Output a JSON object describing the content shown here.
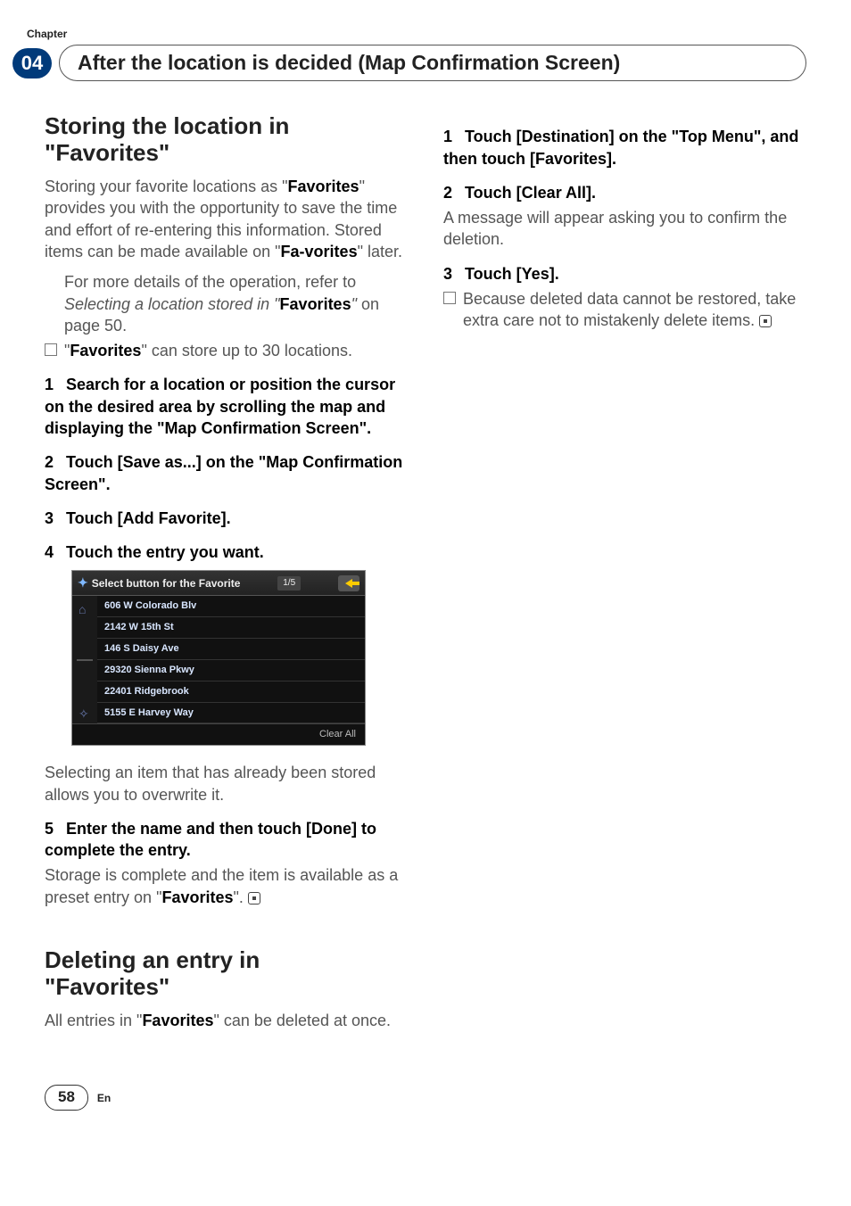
{
  "header": {
    "chapter_label": "Chapter",
    "chapter_num": "04",
    "title": "After the location is decided (Map Confirmation Screen)"
  },
  "left": {
    "sec1_title_a": "Storing the location in",
    "sec1_title_b": "\"Favorites\"",
    "sec1_para_a": "Storing your favorite locations as \"",
    "sec1_para_b": "Favorites",
    "sec1_para_c": "\" provides you with the opportunity to save the time and effort of re-entering this information. Stored items can be made available on \"",
    "sec1_para_d": "Fa-vorites",
    "sec1_para_e": "\" later.",
    "bul1_a": "For more details of the operation, refer to ",
    "bul1_b": "Selecting a location stored in \"",
    "bul1_c": "Favorites",
    "bul1_d": "\" ",
    "bul1_e": "on page 50.",
    "bul2_a": "\"",
    "bul2_b": "Favorites",
    "bul2_c": "\" can store up to 30 locations.",
    "step1": "Search for a location or position the cursor on the desired area by scrolling the map and displaying the \"Map Confirmation Screen\".",
    "step2": "Touch [Save as...] on the \"Map Confirmation Screen\".",
    "step3": "Touch [Add Favorite].",
    "step4": "Touch the entry you want.",
    "favshot": {
      "title": "Select button for the Favorite",
      "page": "1/5",
      "rows": [
        "606 W Colorado Blv",
        "2142 W 15th St",
        "146 S Daisy Ave",
        "29320 Sienna Pkwy",
        "22401 Ridgebrook",
        "5155 E Harvey Way"
      ],
      "clear": "Clear All"
    },
    "after_shot": "Selecting an item that has already been stored allows you to overwrite it.",
    "step5": "Enter the name and then touch [Done] to complete the entry.",
    "step5_after_a": "Storage is complete and the item is available as a preset entry on \"",
    "step5_after_b": "Favorites",
    "step5_after_c": "\".",
    "sec2_title_a": "Deleting an entry in",
    "sec2_title_b": "\"Favorites\"",
    "sec2_para_a": "All entries in \"",
    "sec2_para_b": "Favorites",
    "sec2_para_c": "\" can be deleted at once."
  },
  "right": {
    "step1": "Touch [Destination] on the \"Top Menu\", and then touch [Favorites].",
    "step2": "Touch [Clear All].",
    "step2_after": "A message will appear asking you to confirm the deletion.",
    "step3": "Touch [Yes].",
    "step3_bul": "Because deleted data cannot be restored, take extra care not to mistakenly delete items."
  },
  "footer": {
    "pagenum": "58",
    "lang": "En"
  },
  "num": {
    "n1": "1",
    "n2": "2",
    "n3": "3",
    "n4": "4",
    "n5": "5"
  }
}
